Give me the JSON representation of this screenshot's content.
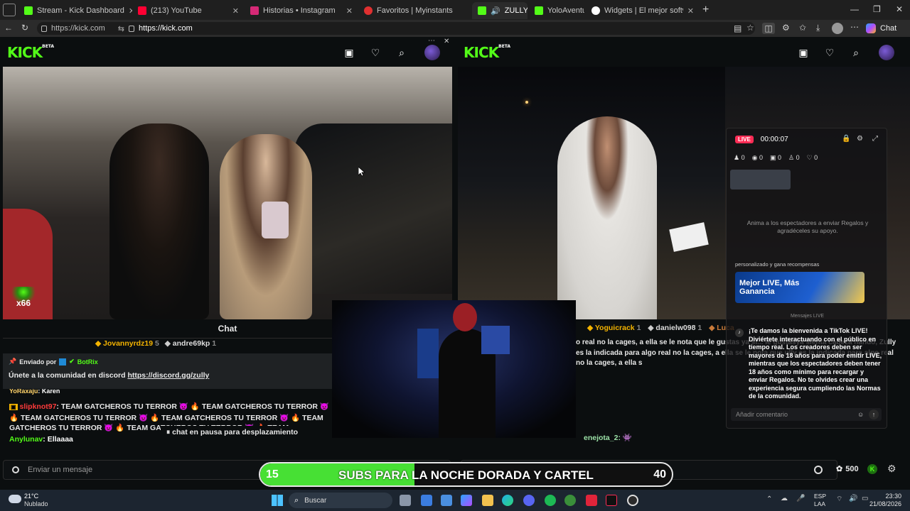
{
  "tabs": [
    {
      "label": "Stream - Kick Dashboard",
      "color": "#53fc18"
    },
    {
      "label": "(213) YouTube",
      "color": "#ff0033"
    },
    {
      "label": "Historias • Instagram",
      "color": "#d62976"
    },
    {
      "label": "Favoritos | Myinstants",
      "color": "#e03030"
    },
    {
      "label": "ZULLY",
      "color": "#53fc18"
    },
    {
      "label": "YoloAventu",
      "color": "#53fc18"
    },
    {
      "label": "Widgets | El mejor software para p",
      "color": "#ffffff"
    }
  ],
  "address": {
    "site_label": "https://kick.com",
    "url": "https://kick.com"
  },
  "browser": {
    "chat_label": "Chat"
  },
  "left_pane": {
    "logo": "KICK",
    "beta": "BETA",
    "badge": "x66",
    "chat_title": "Chat",
    "gifters": [
      {
        "name": "Jovannyrdz19",
        "count": "5"
      },
      {
        "name": "andre69kp",
        "count": "1"
      }
    ],
    "pinned": {
      "sent_by": "Enviado por",
      "bot": "BotRix",
      "text": "Únete a la comunidad en discord ",
      "link": "https://discord.gg/zully"
    },
    "messages": [
      {
        "user": "YoRaxaju",
        "text": "Karen"
      },
      {
        "user": "slipknot97",
        "text": "TEAM GATCHEROS TU TERROR 👿 🔥 TEAM GATCHEROS TU TERROR 👿 🔥 TEAM GATCHEROS TU TERROR 👿 🔥 TEAM GATCHEROS TU TERROR 👿 🔥 TEAM GATCHEROS TU TERROR 👿 🔥 TEAM GATCHEROS TU TERROR 👿 🔥 TEAM GATCHEROS TU TERROR 👿 🔥 TEAM GATCHEROS TU TERROR 👿 🔥 TEAM GATC"
      },
      {
        "user": "Anylunav",
        "text": "Ellaaaa"
      }
    ],
    "paused": "chat en pausa para desplazamiento",
    "input_placeholder": "Enviar un mensaje"
  },
  "right_pane": {
    "logo": "KICK",
    "beta": "BETA",
    "gifters": [
      {
        "name": "Yoguicrack",
        "count": "1"
      },
      {
        "name": "danielw098",
        "count": "1"
      },
      {
        "name": "Luca",
        "count": "1"
      }
    ],
    "pinned_text": "o real no la cages, a ella se le nota que le gustas ya si... le gustasya sienta cabeza nando, Zully es la indicada para algo real no la cages, a ella se le nota que ully es la indicada para algo real no la cages, a ella s",
    "chat_user": "enejota_2:",
    "points": "500"
  },
  "tiktok": {
    "live": "LIVE",
    "timer": "00:00:07",
    "stats": [
      "0",
      "0",
      "0",
      "0",
      "0"
    ],
    "gift_prompt": "Anima a los espectadores a enviar Regalos y agradéceles su apoyo.",
    "promo_header": "personalizado y gana recompensas",
    "promo_title": "Mejor LIVE, Más Ganancia",
    "section": "Mensajes LIVE",
    "welcome": "¡Te damos la bienvenida a TikTok LIVE! Diviértete interactuando con el público en tiempo real. Los creadores deben ser mayores de 18 años para poder emitir LIVE, mientras que los espectadores deben tener 18 años como mínimo para recargar y enviar Regalos. No te olvides crear una experiencia segura cumpliendo las Normas de la comunidad.",
    "comment_placeholder": "Añadir comentario"
  },
  "banner": {
    "left": "15",
    "text": "SUBS PARA LA NOCHE DORADA Y CARTEL",
    "right": "40"
  },
  "taskbar": {
    "temp": "21°C",
    "weather": "Nublado",
    "search": "Buscar",
    "lang1": "ESP",
    "lang2": "LAA",
    "time": "23:30",
    "date": "21/08/2026"
  }
}
